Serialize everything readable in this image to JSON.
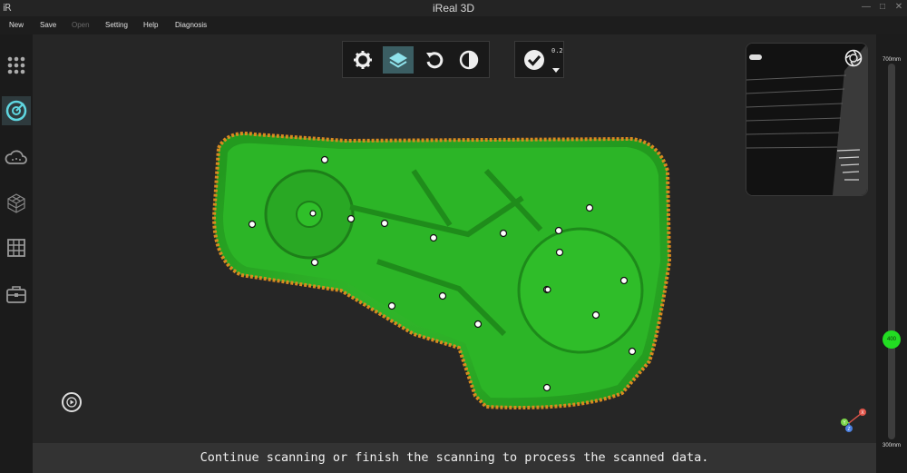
{
  "window": {
    "logo": "iR",
    "title": "iReal 3D",
    "controls": [
      "—",
      "□",
      "✕"
    ]
  },
  "menu": {
    "new": "New",
    "save": "Save",
    "open": "Open",
    "setting": "Setting",
    "help": "Help",
    "diagnosis": "Diagnosis"
  },
  "sidebar": {
    "items": [
      "markers-grid-icon",
      "scan-radar-icon",
      "cloud-points-icon",
      "mesh-cube-icon",
      "grid-table-icon",
      "toolbox-icon"
    ],
    "active_index": 1
  },
  "toolbar": {
    "items": [
      "settings-gear-icon",
      "layers-icon",
      "undo-icon",
      "contrast-icon"
    ],
    "active_index": 1
  },
  "resolution": {
    "value": "0.2",
    "status_color": "#ffffff"
  },
  "depth_range": {
    "max_label": "700mm",
    "min_label": "300mm",
    "current": "400",
    "current_value": 400,
    "indicator_color": "#22dd22"
  },
  "axes": {
    "x": "X",
    "y": "Y",
    "z": "Z",
    "x_color": "#e0554a",
    "y_color": "#7cd64a",
    "z_color": "#4a7fe0"
  },
  "status": {
    "message": "Continue scanning or finish the scanning to process the scanned data."
  },
  "model": {
    "color": "#2fb82a",
    "edge_color": "#d98a1f"
  }
}
